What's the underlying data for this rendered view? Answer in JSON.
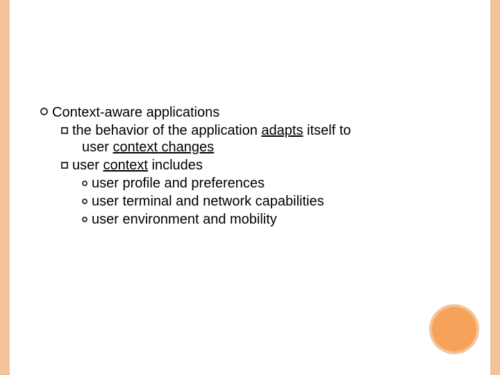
{
  "slide": {
    "l1": {
      "t1": "Context-aware",
      "t2": " applications"
    },
    "l2a": {
      "t1": "the",
      "t2": " behavior of the application ",
      "u1": "adapts",
      "u2": " itself to",
      "cont1": "user ",
      "cont2": "context changes"
    },
    "l2b": {
      "t1": "user ",
      "u1": "context",
      "t2": " includes"
    },
    "l3a": {
      "t1": "user",
      "t2": " profile and preferences"
    },
    "l3b": {
      "t1": "user",
      "t2": " terminal and network capabilities"
    },
    "l3c": {
      "t1": "user",
      "t2": " environment and mobility"
    }
  }
}
